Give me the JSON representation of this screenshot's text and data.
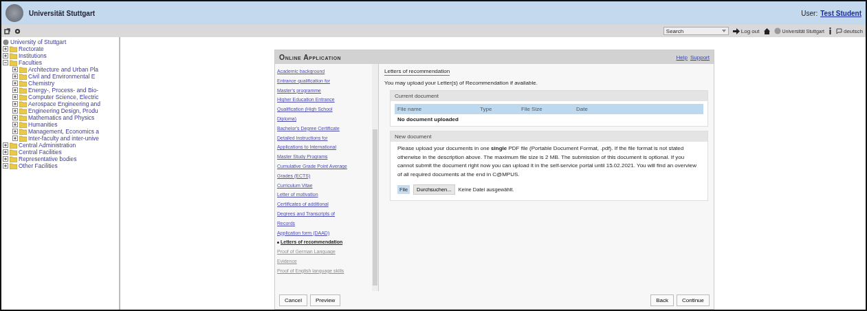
{
  "header": {
    "title": "Universität Stuttgart",
    "user_label": "User:",
    "user_name": "Test Student"
  },
  "toolbar": {
    "search": "Search",
    "logout": "Log out",
    "org": "Universität Stuttgart",
    "language": "deutsch"
  },
  "tree": {
    "label": "University of Stuttgart",
    "children": [
      {
        "label": "Rectorate",
        "expanded": false
      },
      {
        "label": "Institutions",
        "expanded": false
      },
      {
        "label": "Faculties",
        "expanded": true,
        "children": [
          {
            "label": "Architecture and Urban Pla",
            "expanded": false
          },
          {
            "label": "Civil and Environmental E",
            "expanded": false
          },
          {
            "label": "Chemistry",
            "expanded": false
          },
          {
            "label": "Energy-, Process- and Bio-",
            "expanded": false
          },
          {
            "label": "Computer Science, Electric",
            "expanded": false
          },
          {
            "label": "Aerospace Engineering and",
            "expanded": false
          },
          {
            "label": "Engineering Design, Produ",
            "expanded": false
          },
          {
            "label": "Mathematics and Physics",
            "expanded": false
          },
          {
            "label": "Humanities",
            "expanded": false
          },
          {
            "label": "Management, Economics a",
            "expanded": false
          },
          {
            "label": "Inter-faculty and inter-unive",
            "expanded": false
          }
        ]
      },
      {
        "label": "Central Administration",
        "expanded": false
      },
      {
        "label": "Central Facilities",
        "expanded": false
      },
      {
        "label": "Representative bodies",
        "expanded": false
      },
      {
        "label": "Other Facilities",
        "expanded": false
      }
    ]
  },
  "dialog": {
    "title": "Online Application",
    "links": [
      "Help",
      "Support"
    ],
    "nav": [
      {
        "label": "Academic background",
        "selected": false,
        "disabled": false
      },
      {
        "label": "Entrance qualification for",
        "selected": false,
        "disabled": false
      },
      {
        "label": "Master's programme",
        "selected": false,
        "disabled": false
      },
      {
        "label": "Higher Education Entrance",
        "selected": false,
        "disabled": false
      },
      {
        "label": "Qualification (High School",
        "selected": false,
        "disabled": false
      },
      {
        "label": "Diploma)",
        "selected": false,
        "disabled": false
      },
      {
        "label": "Bachelor's Degree Certificate",
        "selected": false,
        "disabled": false
      },
      {
        "label": "Detailed Instructions for",
        "selected": false,
        "disabled": false
      },
      {
        "label": "Applications to International",
        "selected": false,
        "disabled": false
      },
      {
        "label": "Master Study Programs",
        "selected": false,
        "disabled": false
      },
      {
        "label": "Cumulative Grade Point Average",
        "selected": false,
        "disabled": false
      },
      {
        "label": "Grades (ECTS)",
        "selected": false,
        "disabled": false
      },
      {
        "label": "Curriculum Vitae",
        "selected": false,
        "disabled": false
      },
      {
        "label": "Letter of motivation",
        "selected": false,
        "disabled": false
      },
      {
        "label": "Certificates of additional",
        "selected": false,
        "disabled": false
      },
      {
        "label": "Degrees and Transcripts of",
        "selected": false,
        "disabled": false
      },
      {
        "label": "Records",
        "selected": false,
        "disabled": false
      },
      {
        "label": "Application form (DAAD)",
        "selected": false,
        "disabled": false
      },
      {
        "label": "Letters of recommendation",
        "selected": true,
        "disabled": false
      },
      {
        "label": "Proof of German Language",
        "selected": false,
        "disabled": true
      },
      {
        "label": "Evidence",
        "selected": false,
        "disabled": true
      },
      {
        "label": "Proof of English language skills",
        "selected": false,
        "disabled": true
      }
    ],
    "heading": "Letters of recommendation",
    "intro": "You may upload your Letter(s) of Recommendation if available.",
    "current": {
      "legend": "Current document",
      "columns": [
        "File name",
        "Type",
        "File Size",
        "Date"
      ],
      "empty": "No document uploaded"
    },
    "new": {
      "legend": "New document",
      "text": "Please upload your documents in one **single** PDF file (Portable Document Format, .pdf). If the file format is not stated otherwise in the description above. The maximum file size is 2 MB. The submission of this document is optional. If you cannot submit the document right now you can upload it in the self-service portal until 15.02.2021. You will find an overview of all required documents at the end in C@MPUS.",
      "file_label": "File",
      "browse": "Durchsuchen...",
      "no_file": "Keine Datei ausgewählt."
    },
    "left_buttons": [
      "Cancel",
      "Preview"
    ],
    "right_buttons": [
      "Back",
      "Continue"
    ]
  }
}
